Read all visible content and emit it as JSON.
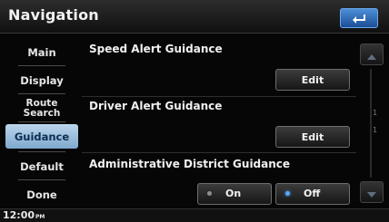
{
  "title": "Navigation",
  "sidebar": {
    "items": [
      {
        "label": "Main"
      },
      {
        "label": "Display"
      },
      {
        "label": "Route Search"
      },
      {
        "label": "Guidance"
      },
      {
        "label": "Default"
      },
      {
        "label": "Done"
      }
    ],
    "selected": "Guidance"
  },
  "settings": {
    "speed_alert": {
      "label": "Speed Alert Guidance",
      "button": "Edit"
    },
    "driver_alert": {
      "label": "Driver Alert Guidance",
      "button": "Edit"
    },
    "admin_district": {
      "label": "Administrative District Guidance",
      "options": [
        {
          "label": "On"
        },
        {
          "label": "Off"
        }
      ],
      "selected": "Off"
    }
  },
  "scroll": {
    "page_marks": [
      "1",
      "1"
    ]
  },
  "status": {
    "time": "12:00",
    "ampm": "PM"
  },
  "colors": {
    "accent_blue": "#55a8ff",
    "selected_tab": "#9fbfdd",
    "background": "#060606"
  }
}
